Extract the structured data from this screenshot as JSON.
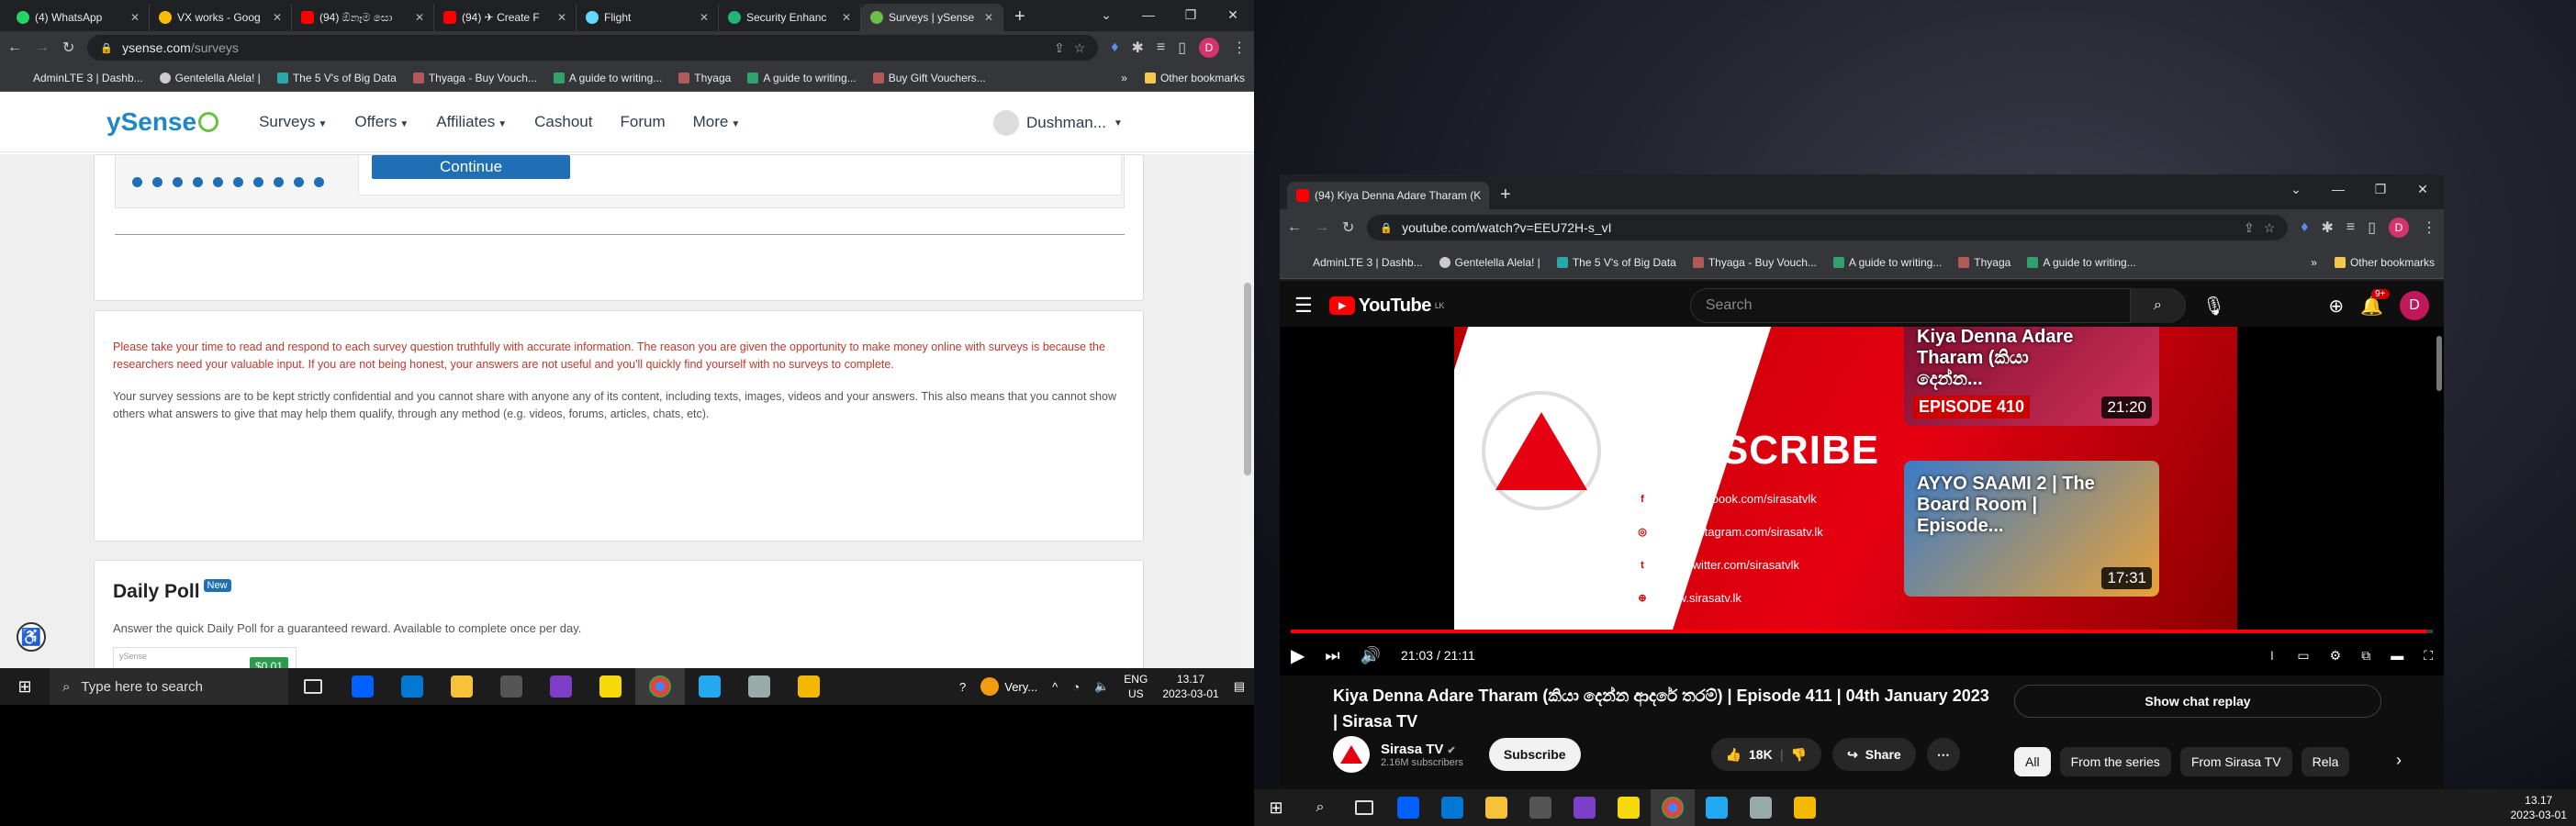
{
  "left_browser": {
    "tabs": [
      "(4) WhatsApp",
      "VX works - Goog",
      "(94) ඕනෑම සො",
      "(94) ✈ Create F",
      "Flight",
      "Security Enhanc",
      "Surveys | ySense"
    ],
    "url_domain": "ysense.com",
    "url_path": "/surveys",
    "bookmarks": [
      "AdminLTE 3 | Dashb...",
      "Gentelella Alela! |",
      "The 5 V's of Big Data",
      "Thyaga - Buy Vouch...",
      "A guide to writing...",
      "Thyaga",
      "A guide to writing...",
      "Buy Gift Vouchers..."
    ],
    "other_bookmarks": "Other bookmarks",
    "profile_initial": "D"
  },
  "ysense": {
    "logo": "ySense",
    "nav": [
      "Surveys",
      "Offers",
      "Affiliates",
      "Cashout",
      "Forum",
      "More"
    ],
    "user": "Dushman...",
    "continue_button": "Continue",
    "warning": "Please take your time to read and respond to each survey question truthfully with accurate information. The reason you are given the opportunity to make money online with surveys is because the researchers need your valuable input. If you are not being honest, your answers are not useful and you'll quickly find yourself with no surveys to complete.",
    "confidential": "Your survey sessions are to be kept strictly confidential and you cannot share with anyone any of its content, including texts, images, videos and your answers. This also means that you cannot show others what answers to give that may help them qualify, through any method (e.g. videos, forums, articles, chats, etc).",
    "poll_title": "Daily Poll",
    "poll_badge": "New",
    "poll_desc": "Answer the quick Daily Poll for a guaranteed reward. Available to complete once per day.",
    "poll_reward": "$0.01",
    "poll_brand": "ySense"
  },
  "left_taskbar": {
    "search_placeholder": "Type here to search",
    "weather": "Very...",
    "lang": "ENG",
    "region": "US",
    "time": "13.17",
    "date": "2023-03-01"
  },
  "right_browser": {
    "tab_title": "(94) Kiya Denna Adare Tharam (K",
    "url": "youtube.com/watch?v=EEU72H-s_vI",
    "bookmarks": [
      "AdminLTE 3 | Dashb...",
      "Gentelella Alela! |",
      "The 5 V's of Big Data",
      "Thyaga - Buy Vouch...",
      "A guide to writing...",
      "Thyaga",
      "A guide to writing..."
    ],
    "other_bookmarks": "Other bookmarks",
    "profile_initial": "D"
  },
  "youtube": {
    "logo": "YouTube",
    "country": "LK",
    "search_placeholder": "Search",
    "notif_count": "9+",
    "avatar": "D",
    "video_subscribe": "SUBSCRIBE",
    "video_links": [
      "www.facebook.com/sirasatvlk",
      "www.instagram.com/sirasatv.lk",
      "www.twitter.com/sirasatvlk",
      "www.sirasatv.lk"
    ],
    "end_thumb1_title": "Kiya Denna Adare Tharam (කියා දෙන්න...",
    "end_thumb1_ep": "EPISODE 410",
    "end_thumb1_dur": "21:20",
    "end_thumb2_title": "AYYO SAAMI 2 | The Board Room | Episode...",
    "end_thumb2_dur": "17:31",
    "time_display": "21:03 / 21:11",
    "progress_fraction": 0.994,
    "title": "Kiya Denna Adare Tharam (කියා දෙන්න ආදරේ තරම්) | Episode 411 | 04th January 2023 | Sirasa TV",
    "channel": "Sirasa TV",
    "subscribers": "2.16M subscribers",
    "subscribe_btn": "Subscribe",
    "likes": "18K",
    "share": "Share",
    "show_chat": "Show chat replay",
    "chips": [
      "All",
      "From the series",
      "From Sirasa TV",
      "Rela"
    ]
  },
  "right_taskbar": {
    "time": "13.17",
    "date": "2023-03-01"
  }
}
